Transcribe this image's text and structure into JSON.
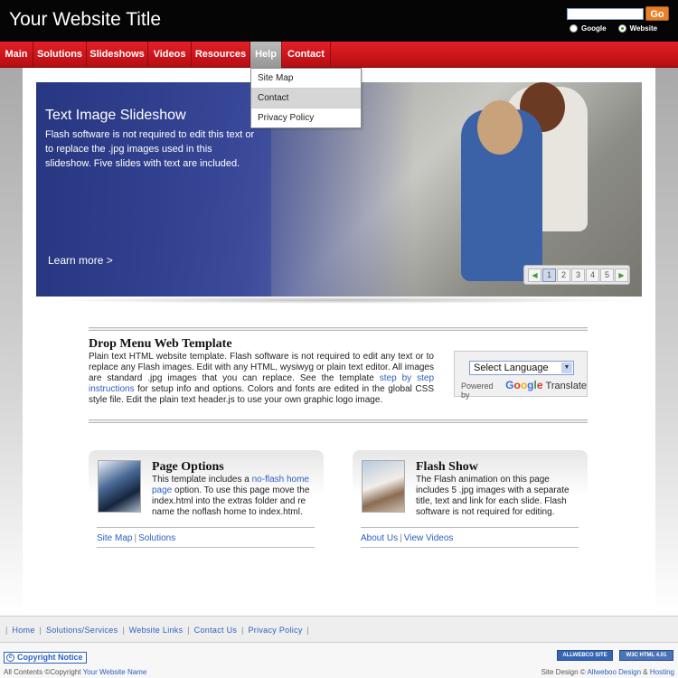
{
  "header": {
    "site_title": "Your Website Title",
    "search_placeholder": "",
    "go_label": "Go",
    "radio_google": "Google",
    "radio_website": "Website"
  },
  "nav": {
    "items": [
      "Main",
      "Solutions",
      "Slideshows",
      "Videos",
      "Resources",
      "Help",
      "Contact"
    ],
    "active": "Help"
  },
  "dropdown": {
    "items": [
      "Site Map",
      "Contact",
      "Privacy Policy"
    ],
    "hovered": "Contact"
  },
  "slideshow": {
    "title": "Text Image Slideshow",
    "text": "Flash software is not required to edit this text or to replace the .jpg images used in this slideshow. Five slides with text are included.",
    "learn_more": "Learn more >",
    "pager": [
      "1",
      "2",
      "3",
      "4",
      "5"
    ],
    "active_page": "1"
  },
  "main": {
    "heading": "Drop Menu Web Template",
    "text_1": "Plain text HTML website template. Flash software is not required to edit any text or to replace any Flash images. Edit with any HTML, wysiwyg or plain text editor. All images are standard .jpg images that you can replace. See the template ",
    "link": "step by step instructions",
    "text_2": " for setup info and options. Colors and fonts are edited in the global CSS style file. Edit the plain text header.js to use your own graphic logo image."
  },
  "translate": {
    "select_label": "Select Language",
    "powered_by": "Powered by",
    "google": [
      "G",
      "o",
      "o",
      "g",
      "l",
      "e"
    ],
    "translate_word": "Translate"
  },
  "boxes": {
    "page_options": {
      "title": "Page Options",
      "text_1": "This template includes a ",
      "link": "no-flash home page",
      "text_2": " option. To use this page move the index.html into the extras folder and re name the noflash home to index.html.",
      "link_a": "Site Map",
      "link_b": "Solutions"
    },
    "flash_show": {
      "title": "Flash Show",
      "text": "The Flash animation on this page includes 5 .jpg images with a separate title, text and link for each slide. Flash software is not required for editing.",
      "link_a": "About Us",
      "link_b": "View Videos"
    }
  },
  "footer": {
    "links": [
      "Home",
      "Solutions/Services",
      "Website Links",
      "Contact Us",
      "Privacy Policy"
    ],
    "copyright_notice": "Copyright Notice",
    "all_contents": "All Contents ©Copyright",
    "site_name": "Your Website Name",
    "site_design": "Site Design ©",
    "designer": "Allweboo Design",
    "amp": "&",
    "hosting": "Hosting",
    "badge_a": "ALLWEBCO SITE",
    "badge_b": "W3C HTML 4.01"
  }
}
